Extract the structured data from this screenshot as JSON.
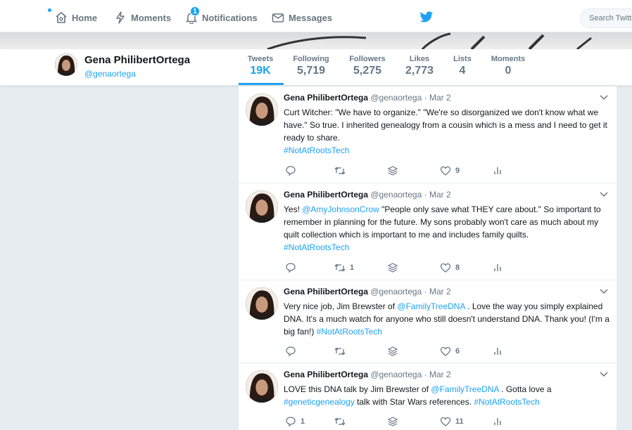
{
  "nav": {
    "home": "Home",
    "moments": "Moments",
    "notifications": "Notifications",
    "notifications_badge": "1",
    "messages": "Messages",
    "search_placeholder": "Search Twitter"
  },
  "profile": {
    "name": "Gena PhilibertOrtega",
    "handle": "@genaortega"
  },
  "stats": [
    {
      "label": "Tweets",
      "value": "19K"
    },
    {
      "label": "Following",
      "value": "5,719"
    },
    {
      "label": "Followers",
      "value": "5,275"
    },
    {
      "label": "Likes",
      "value": "2,773"
    },
    {
      "label": "Lists",
      "value": "4"
    },
    {
      "label": "Moments",
      "value": "0"
    }
  ],
  "tweets": [
    {
      "name": "Gena PhilibertOrtega",
      "meta": "@genaortega · Mar 2",
      "text_1": "Curt Witcher: \"We have to organize.\" \"We're so disorganized we don't know what we have.\" So true. I inherited genealogy from a cousin which is a mess and I need to get it ready to share.",
      "hashtag": "#NotAtRootsTech",
      "replies": "",
      "retweets": "",
      "likes": "9"
    },
    {
      "name": "Gena PhilibertOrtega",
      "meta": "@genaortega · Mar 2",
      "text_1": "Yes! ",
      "mention": "@AmyJohnsonCrow",
      "text_2": "  \"People only save what THEY care about.\" So important to remember in planning for the future. My sons probably won't care as much about my quilt collection which is important to me and includes family quilts.",
      "hashtag": "#NotAtRootsTech",
      "replies": "",
      "retweets": "1",
      "likes": "8"
    },
    {
      "name": "Gena PhilibertOrtega",
      "meta": "@genaortega · Mar 2",
      "text_1": "Very nice job, Jim Brewster of ",
      "mention": "@FamilyTreeDNA",
      "text_2": " . Love the way you simply explained DNA. It's a much watch for anyone who still doesn't understand DNA. Thank you! (I'm a big fan!) ",
      "hashtag": "#NotAtRootsTech",
      "replies": "",
      "retweets": "",
      "likes": "6"
    },
    {
      "name": "Gena PhilibertOrtega",
      "meta": "@genaortega · Mar 2",
      "text_1": "LOVE this DNA talk by Jim Brewster of ",
      "mention": "@FamilyTreeDNA",
      "text_2": " . Gotta love a ",
      "hashtag_mid": "#geneticgenealogy",
      "text_3": " talk with Star Wars references. ",
      "hashtag": "#NotAtRootsTech",
      "replies": "1",
      "retweets": "",
      "likes": "11"
    }
  ],
  "colors": {
    "accent": "#1da1f2",
    "background": "#e6ecf0",
    "muted": "#657786"
  }
}
